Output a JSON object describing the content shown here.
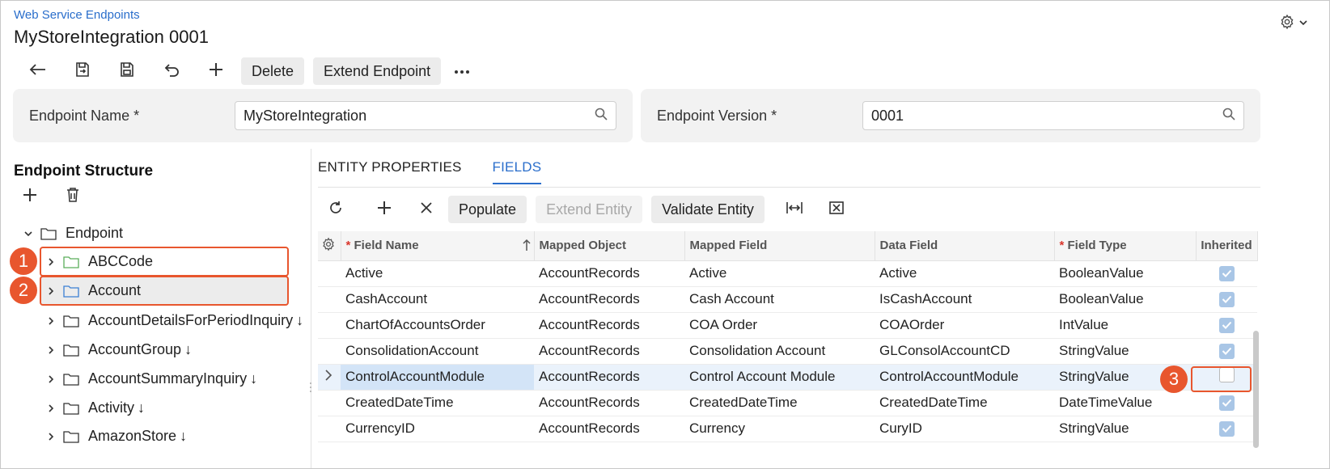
{
  "header": {
    "breadcrumb": "Web Service Endpoints",
    "title": "MyStoreIntegration 0001"
  },
  "toolbar": {
    "delete_label": "Delete",
    "extend_endpoint_label": "Extend Endpoint"
  },
  "form": {
    "endpoint_name_label": "Endpoint Name *",
    "endpoint_name_value": "MyStoreIntegration",
    "endpoint_version_label": "Endpoint Version *",
    "endpoint_version_value": "0001"
  },
  "tree": {
    "title": "Endpoint Structure",
    "root_label": "Endpoint",
    "items": [
      {
        "label": "ABCCode",
        "suffix": "",
        "folder_color": "#5aae5a"
      },
      {
        "label": "Account",
        "suffix": "",
        "folder_color": "#3b7fd4"
      },
      {
        "label": "AccountDetailsForPeriodInquiry",
        "suffix": "↓",
        "folder_color": "#333333"
      },
      {
        "label": "AccountGroup",
        "suffix": "↓",
        "folder_color": "#333333"
      },
      {
        "label": "AccountSummaryInquiry",
        "suffix": "↓",
        "folder_color": "#333333"
      },
      {
        "label": "Activity",
        "suffix": "↓",
        "folder_color": "#333333"
      },
      {
        "label": "AmazonStore",
        "suffix": "↓",
        "folder_color": "#333333"
      }
    ]
  },
  "tabs": {
    "entity_properties": "ENTITY PROPERTIES",
    "fields": "FIELDS"
  },
  "grid_toolbar": {
    "populate": "Populate",
    "extend_entity": "Extend Entity",
    "validate_entity": "Validate Entity"
  },
  "grid": {
    "headers": {
      "field_name": "Field Name",
      "mapped_object": "Mapped Object",
      "mapped_field": "Mapped Field",
      "data_field": "Data Field",
      "field_type": "Field Type",
      "inherited": "Inherited"
    },
    "rows": [
      {
        "field_name": "Active",
        "mapped_object": "AccountRecords",
        "mapped_field": "Active",
        "data_field": "Active",
        "field_type": "BooleanValue",
        "inherited": true
      },
      {
        "field_name": "CashAccount",
        "mapped_object": "AccountRecords",
        "mapped_field": "Cash Account",
        "data_field": "IsCashAccount",
        "field_type": "BooleanValue",
        "inherited": true
      },
      {
        "field_name": "ChartOfAccountsOrder",
        "mapped_object": "AccountRecords",
        "mapped_field": "COA Order",
        "data_field": "COAOrder",
        "field_type": "IntValue",
        "inherited": true
      },
      {
        "field_name": "ConsolidationAccount",
        "mapped_object": "AccountRecords",
        "mapped_field": "Consolidation Account",
        "data_field": "GLConsolAccountCD",
        "field_type": "StringValue",
        "inherited": true
      },
      {
        "field_name": "ControlAccountModule",
        "mapped_object": "AccountRecords",
        "mapped_field": "Control Account Module",
        "data_field": "ControlAccountModule",
        "field_type": "StringValue",
        "inherited": false
      },
      {
        "field_name": "CreatedDateTime",
        "mapped_object": "AccountRecords",
        "mapped_field": "CreatedDateTime",
        "data_field": "CreatedDateTime",
        "field_type": "DateTimeValue",
        "inherited": true
      },
      {
        "field_name": "CurrencyID",
        "mapped_object": "AccountRecords",
        "mapped_field": "Currency",
        "data_field": "CuryID",
        "field_type": "StringValue",
        "inherited": true
      }
    ]
  },
  "callouts": [
    "1",
    "2",
    "3"
  ]
}
